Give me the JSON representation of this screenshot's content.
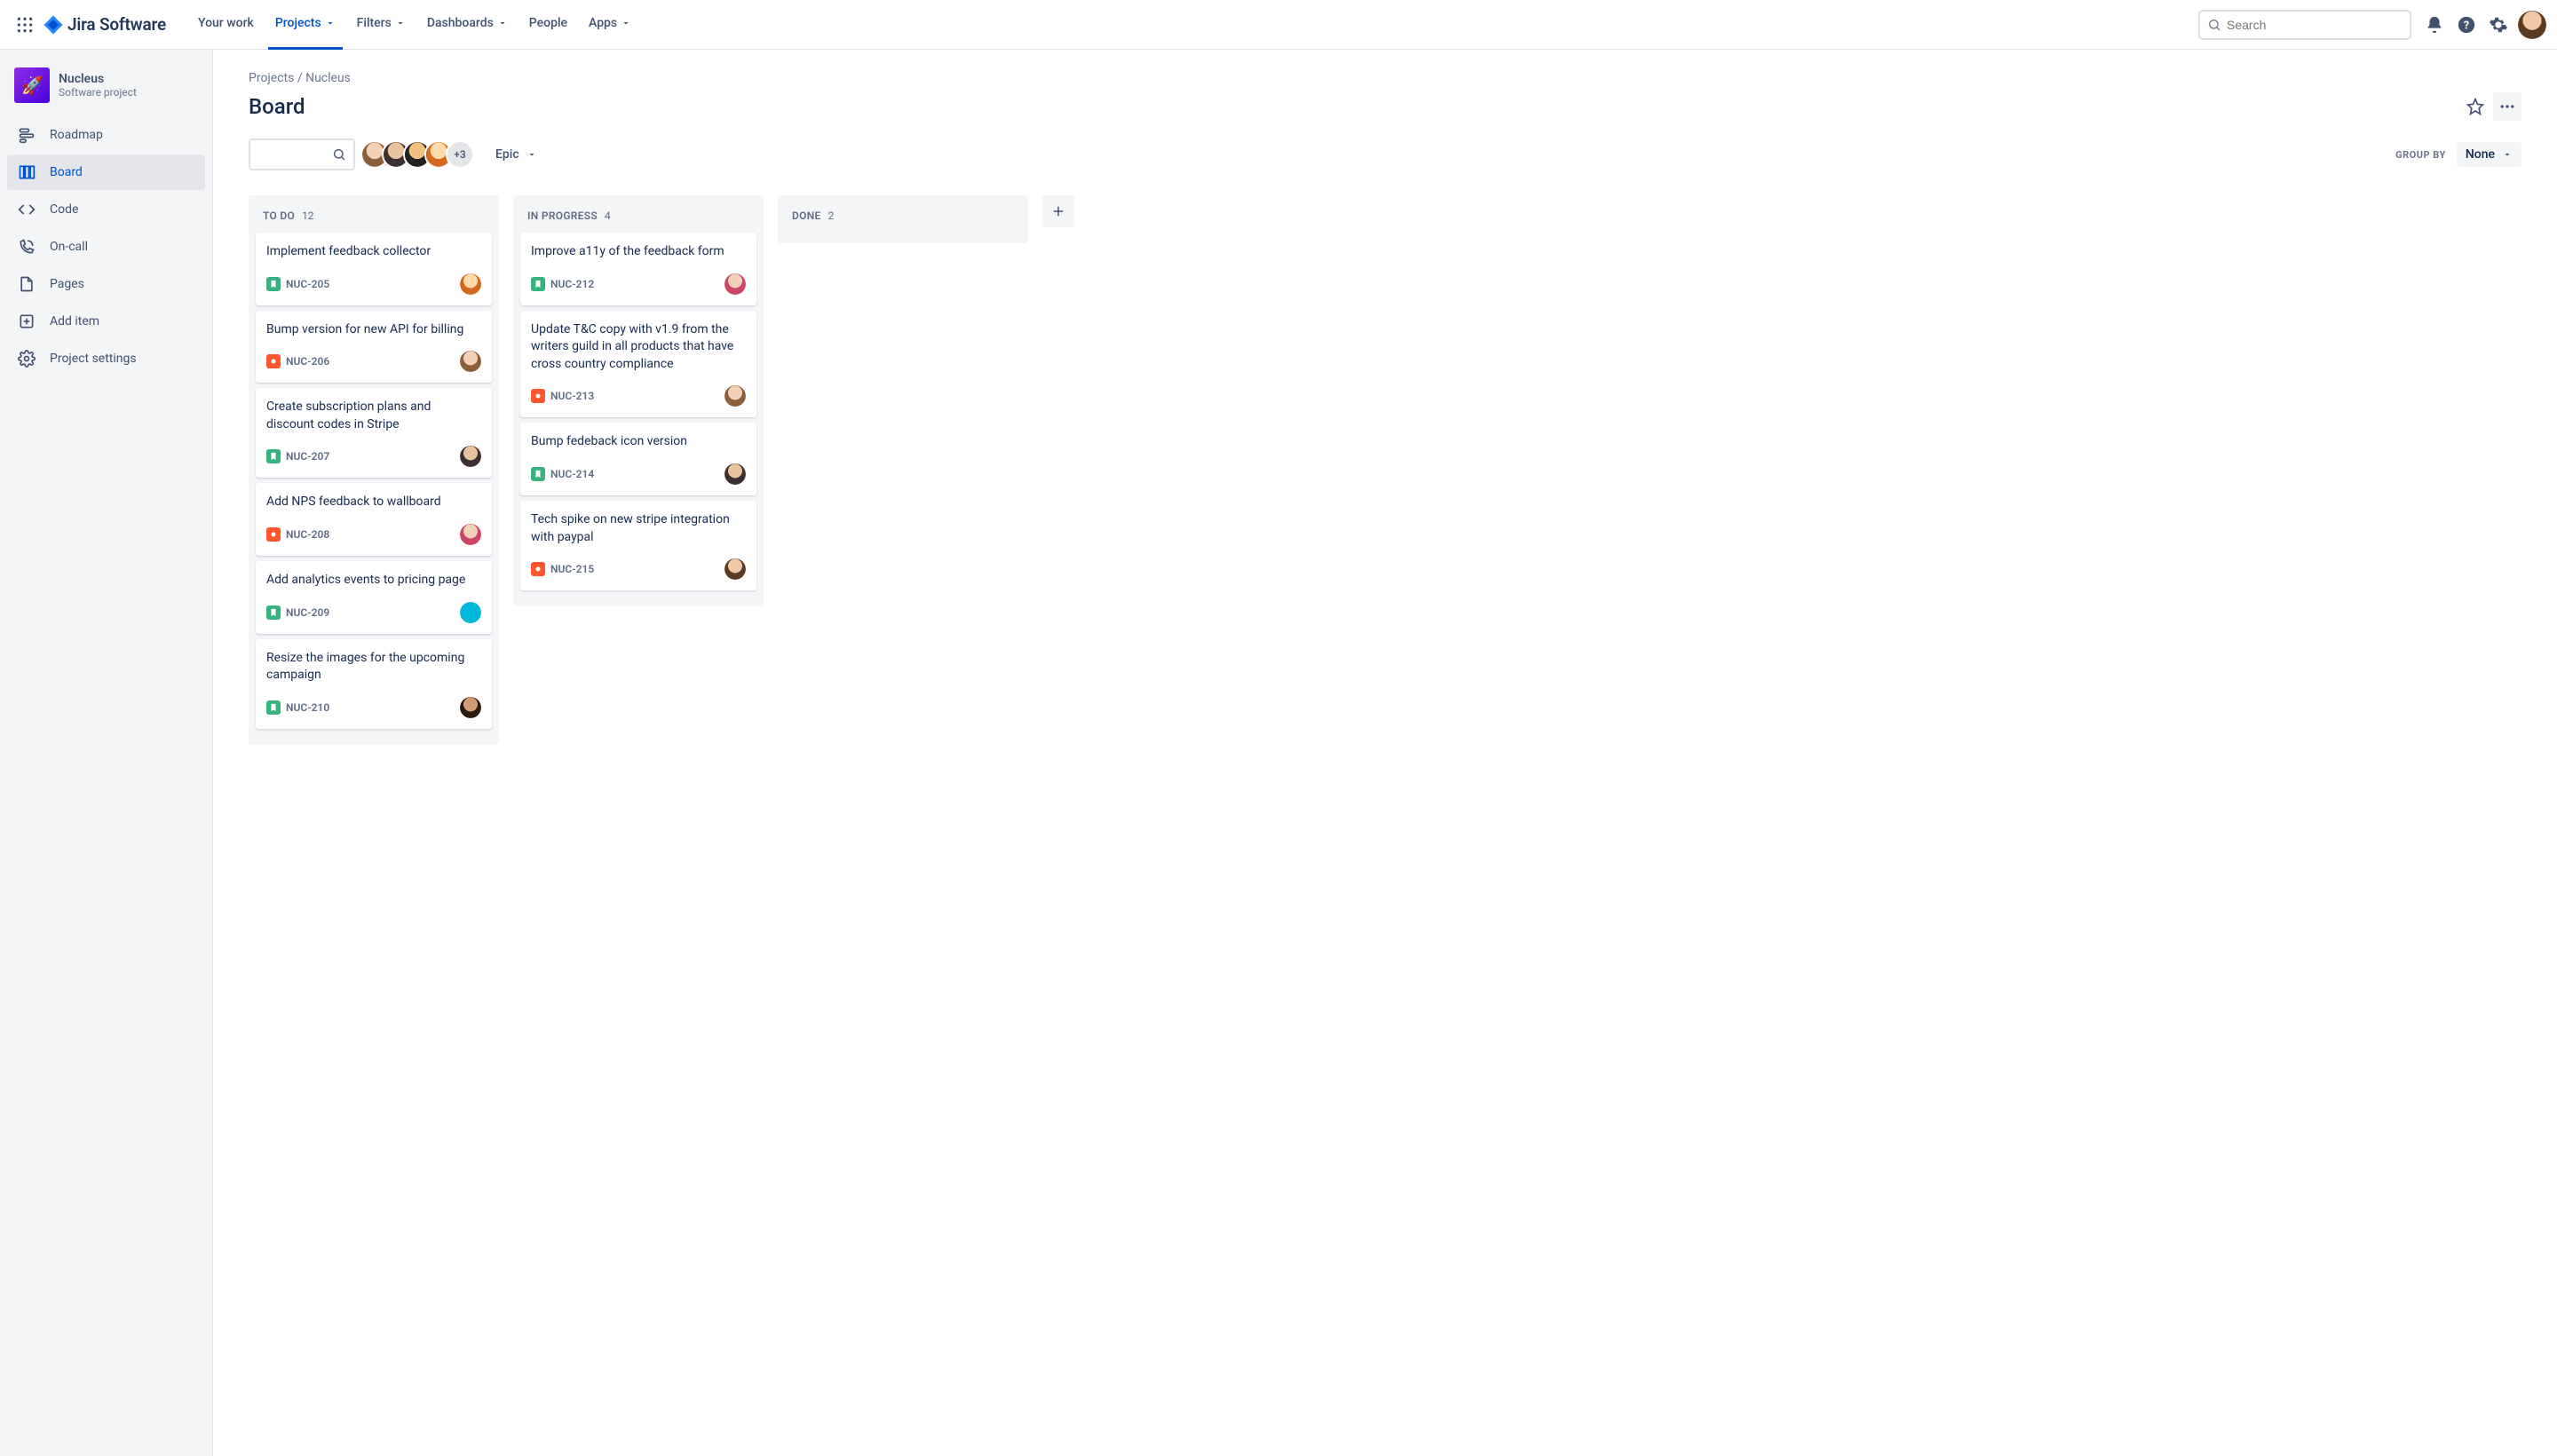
{
  "header": {
    "product": "Jira Software",
    "nav": [
      {
        "label": "Your work",
        "dropdown": false
      },
      {
        "label": "Projects",
        "dropdown": true,
        "active": true
      },
      {
        "label": "Filters",
        "dropdown": true
      },
      {
        "label": "Dashboards",
        "dropdown": true
      },
      {
        "label": "People",
        "dropdown": false
      },
      {
        "label": "Apps",
        "dropdown": true
      }
    ],
    "search_placeholder": "Search"
  },
  "sidebar": {
    "project_name": "Nucleus",
    "project_type": "Software project",
    "items": [
      {
        "label": "Roadmap",
        "icon": "roadmap"
      },
      {
        "label": "Board",
        "icon": "board",
        "active": true
      },
      {
        "label": "Code",
        "icon": "code"
      },
      {
        "label": "On-call",
        "icon": "oncall"
      },
      {
        "label": "Pages",
        "icon": "pages"
      },
      {
        "label": "Add item",
        "icon": "add"
      },
      {
        "label": "Project settings",
        "icon": "settings"
      }
    ]
  },
  "breadcrumbs": {
    "parent": "Projects",
    "current": "Nucleus"
  },
  "page_title": "Board",
  "controls": {
    "epic_label": "Epic",
    "avatar_overflow": "+3",
    "group_by_label": "GROUP BY",
    "group_by_value": "None"
  },
  "columns": [
    {
      "title": "TO DO",
      "count": 12,
      "cards": [
        {
          "title": "Implement feedback collector",
          "key": "NUC-205",
          "type": "story",
          "avatar": "f4"
        },
        {
          "title": "Bump version for new API for billing",
          "key": "NUC-206",
          "type": "bug",
          "avatar": "f1"
        },
        {
          "title": "Create subscription plans and discount codes in Stripe",
          "key": "NUC-207",
          "type": "story",
          "avatar": "f2"
        },
        {
          "title": "Add NPS feedback to wallboard",
          "key": "NUC-208",
          "type": "bug",
          "avatar": "f5"
        },
        {
          "title": "Add analytics events to pricing page",
          "key": "NUC-209",
          "type": "story",
          "avatar": "f6"
        },
        {
          "title": "Resize the images for the upcoming campaign",
          "key": "NUC-210",
          "type": "story",
          "avatar": "f7"
        }
      ]
    },
    {
      "title": "IN PROGRESS",
      "count": 4,
      "cards": [
        {
          "title": "Improve a11y of the feedback form",
          "key": "NUC-212",
          "type": "story",
          "avatar": "f5"
        },
        {
          "title": "Update T&C copy with v1.9 from the writers guild in all products that have cross country compliance",
          "key": "NUC-213",
          "type": "bug",
          "avatar": "f1"
        },
        {
          "title": "Bump fedeback icon version",
          "key": "NUC-214",
          "type": "story",
          "avatar": "f2"
        },
        {
          "title": "Tech spike on new stripe integration with paypal",
          "key": "NUC-215",
          "type": "bug",
          "avatar": "f8"
        }
      ]
    },
    {
      "title": "DONE",
      "count": 2,
      "cards": []
    }
  ]
}
